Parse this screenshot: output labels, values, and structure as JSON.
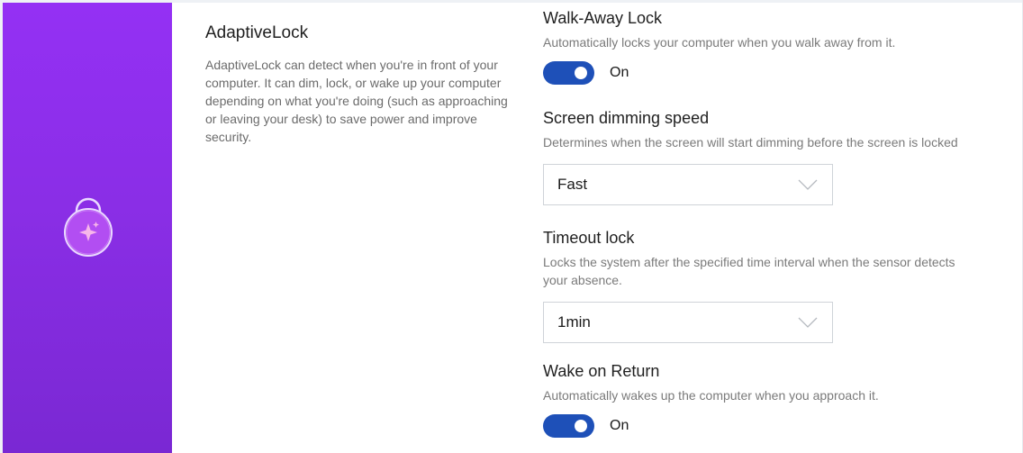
{
  "intro": {
    "title": "AdaptiveLock",
    "description": "AdaptiveLock can detect when you're in front of your computer. It can dim, lock, or wake up your computer depending on what you're doing (such as approaching or leaving your desk) to save power and improve security."
  },
  "banner": {
    "icon": "padlock-sparkle-icon",
    "color": "#8a2ee6"
  },
  "settings": {
    "walk_away": {
      "title": "Walk-Away Lock",
      "description": "Automatically locks your computer when you walk away from it.",
      "toggle_state": "On"
    },
    "dimming": {
      "title": "Screen dimming speed",
      "description": "Determines when the screen will start dimming before the screen is locked",
      "selected": "Fast"
    },
    "timeout": {
      "title": "Timeout lock",
      "description": "Locks the system after the specified time interval when the sensor detects your absence.",
      "selected": "1min"
    },
    "wake": {
      "title": "Wake on Return",
      "description": "Automatically wakes up the computer when you approach it.",
      "toggle_state": "On"
    }
  },
  "colors": {
    "accent": "#1e50b8",
    "banner_top": "#9430f4",
    "banner_bottom": "#7a28d3"
  }
}
